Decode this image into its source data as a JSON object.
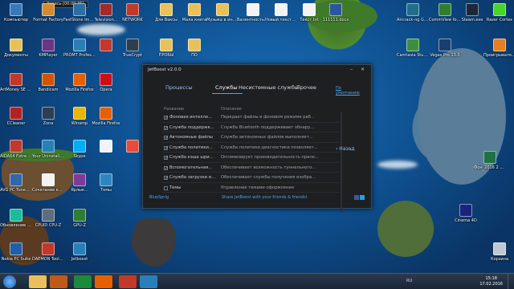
{
  "recording": "Запись [00:00:35]",
  "desktop_icons": [
    {
      "label": "Компьютер",
      "color": "#3a78b8"
    },
    {
      "label": "Format Factory",
      "color": "#d58b2f"
    },
    {
      "label": "FastStone Image Viewer",
      "color": "#2c6fa5"
    },
    {
      "label": "Television...",
      "color": "#a02b2b"
    },
    {
      "label": "NETWORK",
      "color": "#c0392b"
    },
    {
      "label": "Для Ваксы",
      "color": "#e8c15a"
    },
    {
      "label": "Мала книга",
      "color": "#e8c15a"
    },
    {
      "label": "Музыка в интернете",
      "color": "#e8c15a"
    },
    {
      "label": "Валентность.txt",
      "color": "#f3f3f3"
    },
    {
      "label": "Новый текстовый...",
      "color": "#f3f3f3"
    },
    {
      "label": "Текст.txt",
      "color": "#f3f3f3"
    },
    {
      "label": "111111.docx",
      "color": "#2b579a"
    },
    {
      "label": "Aircrack-ng GUI.exe",
      "color": "#1f6f8b"
    },
    {
      "label": "CommView for WiFi",
      "color": "#2e7d32"
    },
    {
      "label": "Steam.exe",
      "color": "#1b2838"
    },
    {
      "label": "Razer Cortex",
      "color": "#44d62c"
    },
    {
      "label": "Документы",
      "color": "#e8c15a"
    },
    {
      "label": "KMPlayer",
      "color": "#6c3483"
    },
    {
      "label": "PROMT Professional",
      "color": "#2980b9"
    },
    {
      "label": "",
      "color": "#c0392b"
    },
    {
      "label": "TrueCrypt",
      "color": "#2c3e50"
    },
    {
      "label": "ПРОБЫ",
      "color": "#e8c15a"
    },
    {
      "label": "ПО",
      "color": "#e8c15a"
    },
    {
      "label": "Camtasia Studio 7",
      "color": "#3d8f3d"
    },
    {
      "label": "Vegas Pro 13.0",
      "color": "#1a3e6e"
    },
    {
      "label": "Проигрыватель",
      "color": "#e67e22"
    },
    {
      "label": "ArtMoney SE v7.41",
      "color": "#c0392b"
    },
    {
      "label": "Bandicam",
      "color": "#d35400"
    },
    {
      "label": "Mozilla Firefox",
      "color": "#e66000"
    },
    {
      "label": "Opera",
      "color": "#cc0f16"
    },
    {
      "label": "CCleaner",
      "color": "#b22222"
    },
    {
      "label": "Zona",
      "color": "#2c3e50"
    },
    {
      "label": "Winamp",
      "color": "#e6b800"
    },
    {
      "label": "Mozilla Firefox",
      "color": "#e66000"
    },
    {
      "label": "AIDA64 Extreme",
      "color": "#c0392b"
    },
    {
      "label": "Your Uninstaller!",
      "color": "#2980b9"
    },
    {
      "label": "Skype",
      "color": "#00aff0"
    },
    {
      "label": "",
      "color": "#f3f3f3"
    },
    {
      "label": "",
      "color": "#e74c3c"
    },
    {
      "label": "AVG PC TuneUp 2014",
      "color": "#3366aa"
    },
    {
      "label": "Сочетание клавиш...",
      "color": "#f3f3f3"
    },
    {
      "label": "Ярлык...",
      "color": "#7d3c98"
    },
    {
      "label": "Темы",
      "color": "#2e86c1"
    },
    {
      "label": "Обновление и устройств...",
      "color": "#1abc9c"
    },
    {
      "label": "CPUID CPU-Z",
      "color": "#5d6d7e"
    },
    {
      "label": "GPU-Z",
      "color": "#2e7d32"
    },
    {
      "label": "Nokia PC Suite",
      "color": "#1f5fa5"
    },
    {
      "label": "DAEMON Tools Lite",
      "color": "#c0392b"
    },
    {
      "label": "Jetboost",
      "color": "#2980b9"
    },
    {
      "label": "Корзина",
      "color": "#bfc9d1"
    },
    {
      "label": "Фон_2016 2 дод27.xls",
      "color": "#1e7145"
    },
    {
      "label": "Cinema 4D",
      "color": "#1a237e"
    }
  ],
  "window": {
    "title": "JetBoost v2.0.0",
    "controls": "–  ×",
    "tabs": [
      "Процессы",
      "Службы",
      "Несистемные службы",
      "Прочее",
      "По умолчанию"
    ],
    "column_name": "Название",
    "column_desc": "Описание",
    "rows": [
      {
        "name": "Фоновая интелле...",
        "desc": "Передает файлы в фоновом режиме раб...",
        "checked": true
      },
      {
        "name": "Служба поддержк...",
        "desc": "Служба Bluetooth поддерживает обнару...",
        "checked": true
      },
      {
        "name": "Автономные файлы",
        "desc": "Служба автономных файлов выполняет...",
        "checked": true
      },
      {
        "name": "Служба политики...",
        "desc": "Служба политики диагностики позволяет...",
        "checked": true
      },
      {
        "name": "Служба кэша шри...",
        "desc": "Оптимизирует производительность прило...",
        "checked": true
      },
      {
        "name": "Вспомогательная...",
        "desc": "Обеспечивает возможность туннельного...",
        "checked": true
      },
      {
        "name": "Служба загрузки и...",
        "desc": "Обеспечивает службы получения изобра...",
        "checked": true
      },
      {
        "name": "Темы",
        "desc": "Управление темами оформления",
        "checked": false
      }
    ],
    "back": "‹ Назад",
    "footer_brand": "BlueSprig",
    "footer_center": "Share JetBoost with your friends & friends!"
  },
  "taskbar": {
    "apps": [
      {
        "name": "windows-explorer",
        "color": "#e8c15a"
      },
      {
        "name": "winamp",
        "color": "#c05a1a"
      },
      {
        "name": "media-player",
        "color": "#1a8a3c"
      },
      {
        "name": "firefox",
        "color": "#e66000"
      },
      {
        "name": "bandicam",
        "color": "#c0392b"
      },
      {
        "name": "jetboost",
        "color": "#2980b9"
      }
    ],
    "lang": "RU",
    "time": "15:18",
    "date": "17.02.2016"
  }
}
